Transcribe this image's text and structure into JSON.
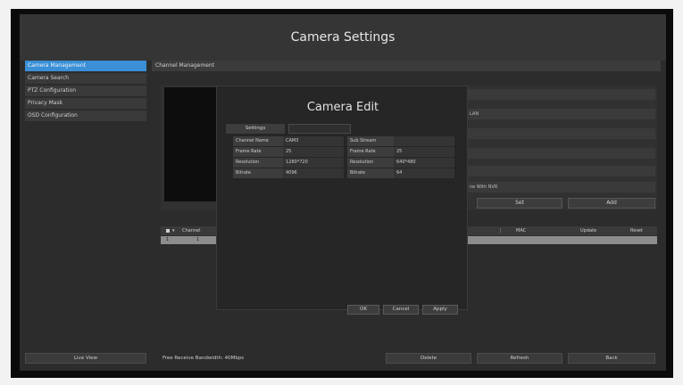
{
  "window": {
    "title": "Camera Settings"
  },
  "sidebar": {
    "items": [
      {
        "label": "Camera Management"
      },
      {
        "label": "Camera Search"
      },
      {
        "label": "PTZ Configuration"
      },
      {
        "label": "Privacy Mask"
      },
      {
        "label": "OSD Configuration"
      }
    ]
  },
  "main": {
    "section_title": "Channel Management",
    "right_rows": [
      "",
      "LAN",
      "",
      "",
      "",
      "ne With NVR"
    ],
    "buttons": {
      "set": "Set",
      "add": "Add"
    },
    "table": {
      "headers": [
        "Channel",
        "MAC",
        "Update",
        "Reset"
      ],
      "row": {
        "index": "1",
        "channel": "1"
      }
    }
  },
  "dialog": {
    "title": "Camera Edit",
    "tabs": {
      "settings": "Settings",
      "second": ""
    },
    "rows": [
      {
        "l1": "Channel Name",
        "v1": "CAM3",
        "l2": "Sub Stream",
        "v2": ""
      },
      {
        "l1": "Frame Rate",
        "v1": "25",
        "l2": "Frame Rate",
        "v2": "25"
      },
      {
        "l1": "Resolution",
        "v1": "1280*720",
        "l2": "Resolution",
        "v2": "640*480"
      },
      {
        "l1": "Bitrate",
        "v1": "4096",
        "l2": "Bitrate",
        "v2": "64"
      }
    ],
    "buttons": {
      "ok": "OK",
      "cancel": "Cancel",
      "apply": "Apply"
    }
  },
  "bottom": {
    "live_view": "Live View",
    "bandwidth": "Free Receive Bandwidth: 40Mbps",
    "delete": "Delete",
    "refresh": "Refresh",
    "back": "Back"
  }
}
